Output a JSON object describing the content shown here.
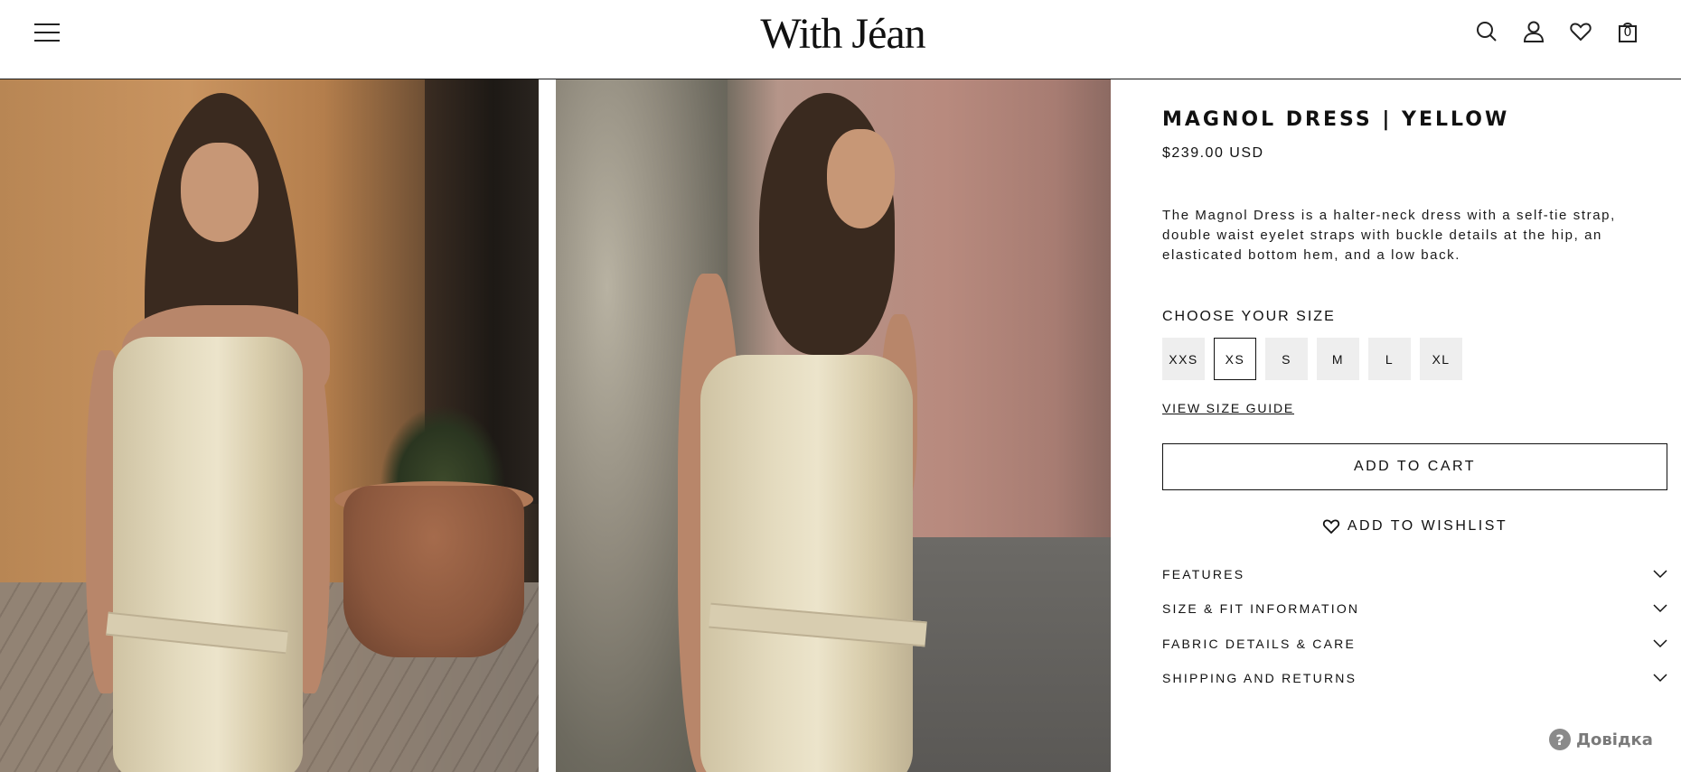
{
  "header": {
    "logo": "With Jéan",
    "cart_count": "0",
    "icons": [
      "menu-icon",
      "search-icon",
      "account-icon",
      "heart-icon",
      "bag-icon"
    ]
  },
  "product": {
    "title": "MAGNOL DRESS | YELLOW",
    "price": "$239.00 USD",
    "description": "The Magnol Dress is a halter-neck dress with a self-tie strap, double waist eyelet straps with buckle details at the hip, an elasticated bottom hem, and a low back.",
    "size_label": "CHOOSE YOUR SIZE",
    "sizes": [
      "XXS",
      "XS",
      "S",
      "M",
      "L",
      "XL"
    ],
    "selected_size": "XS",
    "size_guide": "VIEW SIZE GUIDE",
    "add_to_cart": "ADD TO CART",
    "add_to_wishlist": "ADD TO WISHLIST",
    "accordion": [
      "FEATURES",
      "SIZE & FIT INFORMATION",
      "FABRIC DETAILS & CARE",
      "SHIPPING AND RETURNS"
    ]
  },
  "help": {
    "label": "Довідка"
  },
  "colors": {
    "text": "#111111",
    "size_bg": "#eeeeee",
    "help_gray": "#7a7a7a"
  }
}
